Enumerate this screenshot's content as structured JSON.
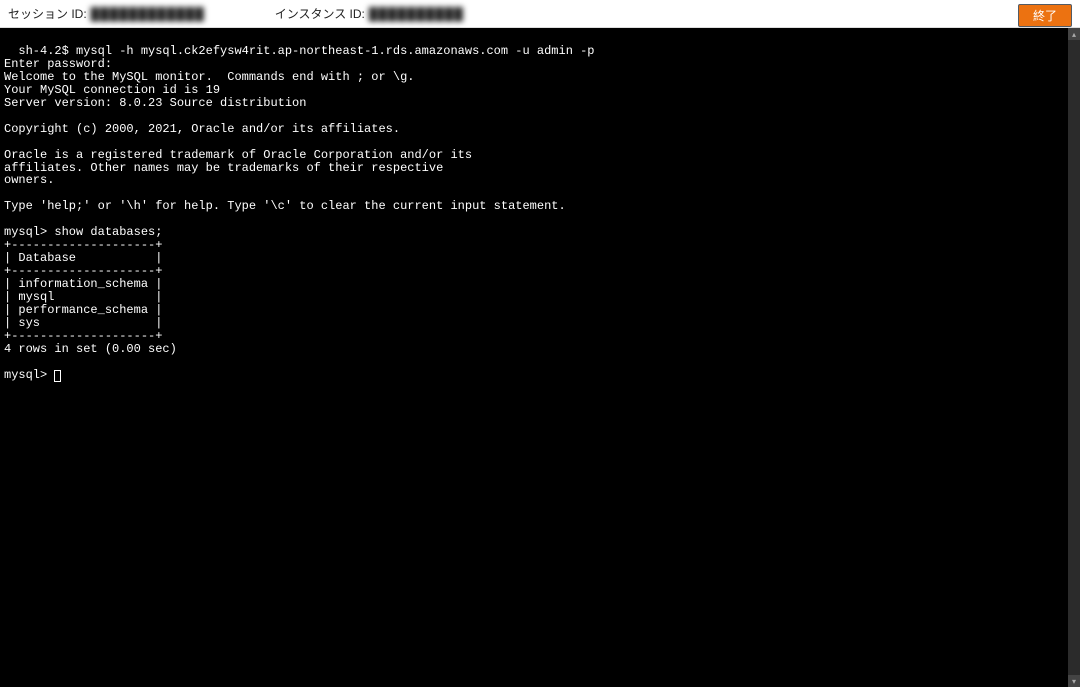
{
  "header": {
    "session_label": "セッション ID:",
    "session_value": "████████████",
    "instance_label": "インスタンス ID:",
    "instance_value": "██████████",
    "exit_label": "終了"
  },
  "terminal": {
    "lines": [
      "sh-4.2$ mysql -h mysql.ck2efysw4rit.ap-northeast-1.rds.amazonaws.com -u admin -p",
      "Enter password:",
      "Welcome to the MySQL monitor.  Commands end with ; or \\g.",
      "Your MySQL connection id is 19",
      "Server version: 8.0.23 Source distribution",
      "",
      "Copyright (c) 2000, 2021, Oracle and/or its affiliates.",
      "",
      "Oracle is a registered trademark of Oracle Corporation and/or its",
      "affiliates. Other names may be trademarks of their respective",
      "owners.",
      "",
      "Type 'help;' or '\\h' for help. Type '\\c' to clear the current input statement.",
      "",
      "mysql> show databases;",
      "+--------------------+",
      "| Database           |",
      "+--------------------+",
      "| information_schema |",
      "| mysql              |",
      "| performance_schema |",
      "| sys                |",
      "+--------------------+",
      "4 rows in set (0.00 sec)",
      "",
      "mysql> "
    ]
  }
}
